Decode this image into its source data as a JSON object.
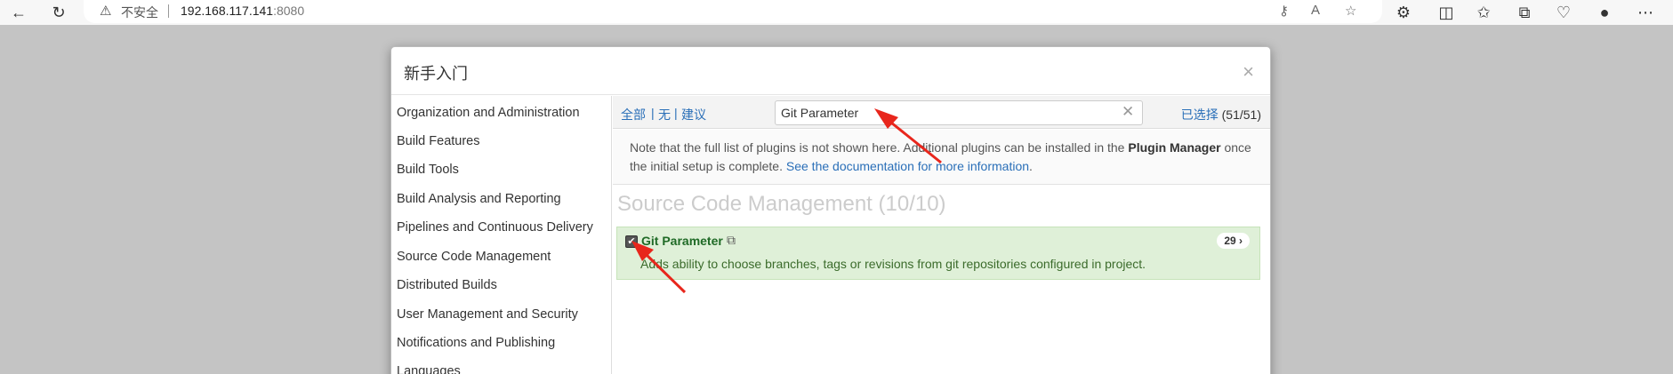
{
  "browser": {
    "security_label": "不安全",
    "host": "192.168.117.141",
    "port": ":8080"
  },
  "modal": {
    "title": "新手入门",
    "close_glyph": "×"
  },
  "sidebar": {
    "items": [
      "Organization and Administration",
      "Build Features",
      "Build Tools",
      "Build Analysis and Reporting",
      "Pipelines and Continuous Delivery",
      "Source Code Management",
      "Distributed Builds",
      "User Management and Security",
      "Notifications and Publishing",
      "Languages"
    ]
  },
  "filter": {
    "all": "全部",
    "none": "无",
    "suggested": "建议",
    "separator": "|",
    "search_value": "Git Parameter",
    "selected_label": "已选择",
    "selected_count": "(51/51)"
  },
  "note": {
    "part1": "Note that the full list of plugins is not shown here. Additional plugins can be installed in the ",
    "plugin_manager": "Plugin Manager",
    "part2": " once the initial setup is complete. ",
    "link": "See the documentation for more information",
    "end": "."
  },
  "section": {
    "title": "Source Code Management (10/10)"
  },
  "plugin": {
    "name": "Git Parameter",
    "description": "Adds ability to choose branches, tags or revisions from git repositories configured in project.",
    "badge": "29 ›",
    "checked": true
  },
  "colors": {
    "link": "#2a6fb8",
    "plugin_bg": "#dff0d8",
    "plugin_name": "#1f6a26",
    "annotation_arrow": "#e8261c"
  }
}
